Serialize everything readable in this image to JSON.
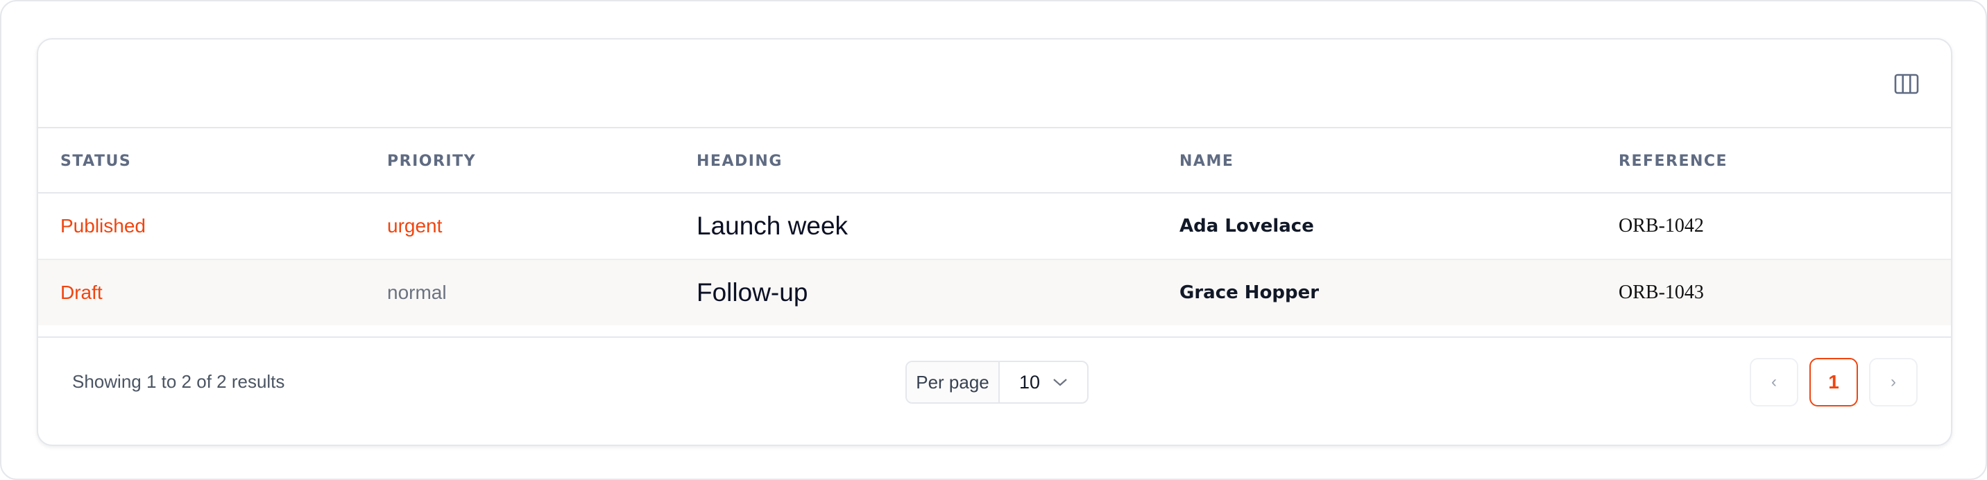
{
  "colors": {
    "accent": "#f0450f",
    "muted": "#5f6b82",
    "border": "#e5e7eb"
  },
  "toolbar": {
    "columns_toggle_icon": "columns-icon"
  },
  "table": {
    "columns": [
      "STATUS",
      "PRIORITY",
      "HEADING",
      "NAME",
      "REFERENCE"
    ],
    "rows": [
      {
        "status": "Published",
        "priority": "urgent",
        "priority_color": "#f0450f",
        "heading": "Launch week",
        "name": "Ada Lovelace",
        "reference": "ORB-1042"
      },
      {
        "status": "Draft",
        "priority": "normal",
        "priority_color": "#6b7280",
        "heading": "Follow-up",
        "name": "Grace Hopper",
        "reference": "ORB-1043"
      }
    ]
  },
  "footer": {
    "summary": "Showing 1 to 2 of 2 results",
    "per_page_label": "Per page",
    "per_page_value": "10",
    "prev_label": "‹",
    "current_page": "1",
    "next_label": "›"
  }
}
